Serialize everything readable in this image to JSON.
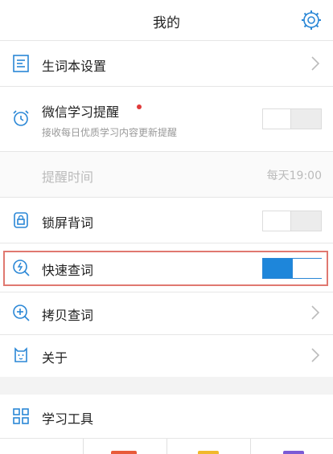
{
  "header": {
    "title": "我的"
  },
  "settings": {
    "vocab_settings": {
      "label": "生词本设置"
    },
    "wechat_reminder": {
      "label": "微信学习提醒",
      "description": "接收每日优质学习内容更新提醒",
      "enabled": false
    },
    "reminder_time": {
      "label": "提醒时间",
      "value": "每天19:00"
    },
    "lockscreen_vocab": {
      "label": "锁屏背词",
      "enabled": false
    },
    "quick_lookup": {
      "label": "快速查词",
      "enabled": true
    },
    "copy_lookup": {
      "label": "拷贝查词"
    },
    "about": {
      "label": "关于"
    }
  },
  "tools": {
    "label": "学习工具"
  },
  "colors": {
    "accent": "#1e86da",
    "highlight_border": "#e07870",
    "notification_dot": "#e03a3a"
  }
}
